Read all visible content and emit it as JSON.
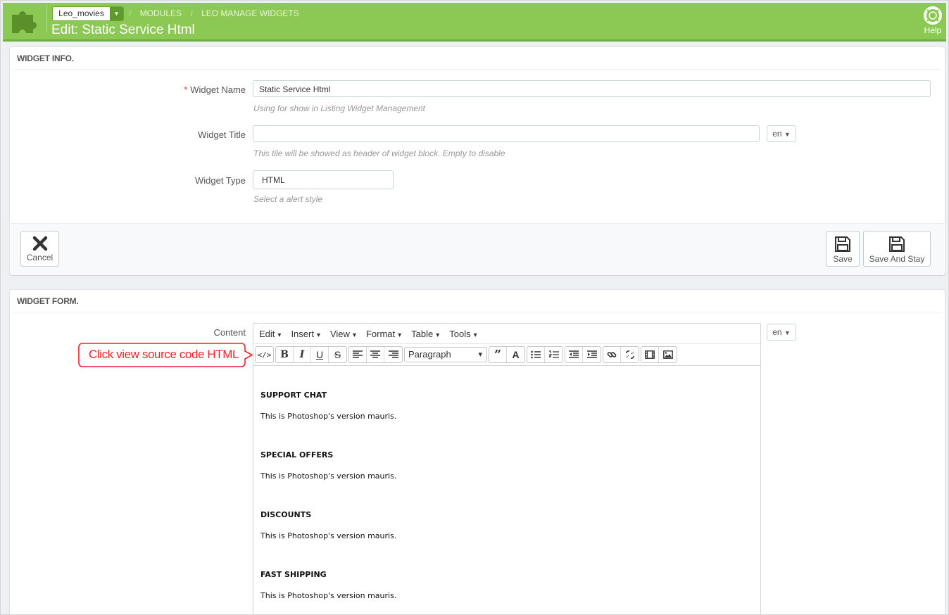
{
  "header": {
    "shop": "Leo_movies",
    "breadcrumbs": [
      "MODULES",
      "LEO MANAGE WIDGETS"
    ],
    "title": "Edit: Static Service Html",
    "help_label": "Help",
    "colors": {
      "bar": "#8bc954",
      "required": "#e0403a",
      "callout": "#e8242b"
    }
  },
  "widget_info": {
    "title": "WIDGET INFO.",
    "fields": {
      "name": {
        "label": "Widget Name",
        "required_mark": "*",
        "value": "Static Service Html",
        "hint": "Using for show in Listing Widget Management"
      },
      "title": {
        "label": "Widget Title",
        "value": "",
        "hint": "This tile will be showed as header of widget block. Empty to disable",
        "lang": "en"
      },
      "type": {
        "label": "Widget Type",
        "value": "HTML",
        "hint": "Select a alert style"
      }
    },
    "buttons": {
      "cancel": "Cancel",
      "save": "Save",
      "save_stay": "Save And Stay"
    }
  },
  "widget_form": {
    "title": "WIDGET FORM.",
    "content_label": "Content",
    "lang": "en",
    "menu": [
      "Edit",
      "Insert",
      "View",
      "Format",
      "Table",
      "Tools"
    ],
    "paragraph": "Paragraph",
    "toolbar_icons": [
      "source-code-icon",
      "bold-icon",
      "italic-icon",
      "underline-icon",
      "strikethrough-icon",
      "align-left-icon",
      "align-center-icon",
      "align-right-icon",
      "blockquote-icon",
      "text-color-icon",
      "bullet-list-icon",
      "numbered-list-icon",
      "outdent-icon",
      "indent-icon",
      "link-icon",
      "unlink-icon",
      "media-icon",
      "image-icon"
    ],
    "toolbar_glyphs": {
      "bold": "B",
      "italic": "I",
      "underline": "U",
      "strike": "S"
    },
    "body": [
      {
        "heading": "SUPPORT CHAT",
        "text": "This is Photoshop's version mauris."
      },
      {
        "heading": "SPECIAL OFFERS",
        "text": "This is Photoshop's version mauris."
      },
      {
        "heading": "DISCOUNTS",
        "text": "This is Photoshop's version mauris."
      },
      {
        "heading": "FAST SHIPPING",
        "text": "This is Photoshop's version mauris."
      }
    ]
  },
  "callout": {
    "text": "Click view source code HTML"
  }
}
